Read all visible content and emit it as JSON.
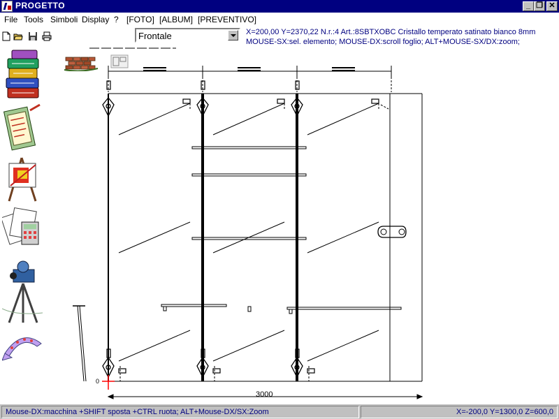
{
  "window": {
    "title": "PROGETTO",
    "min_glyph": "_",
    "restore_glyph": "❐",
    "close_glyph": "✕"
  },
  "menu": [
    "File",
    "Tools",
    "Simboli",
    "Display",
    "?",
    "[FOTO]",
    "[ALBUM]",
    "[PREVENTIVO]"
  ],
  "toolbar": {
    "view_select": "Frontale",
    "coord_line": "X=200,00    Y=2370,22  N.r.:4 Art.:8SBTXOBC Cristallo temperato satinato bianco 8mm",
    "hint_line": "MOUSE-SX:sel. elemento; MOUSE-DX:scroll foglio; ALT+MOUSE-SX/DX:zoom;"
  },
  "drawing": {
    "width_dimension": "3000",
    "origin_label": "0"
  },
  "status": {
    "left": "Mouse-DX:macchina +SHIFT sposta +CTRL ruota; ALT+Mouse-DX/SX:Zoom",
    "right": "X=-200,0 Y=1300,0 Z=600,0"
  },
  "colors": {
    "titlebar": "#000080",
    "info_text": "#000080",
    "origin_axis": "#ff0000"
  },
  "icons": [
    "new-file-icon",
    "open-folder-icon",
    "save-disk-icon",
    "print-icon",
    "brick-wall-icon",
    "layout-view-icon",
    "books-icon",
    "clipboard-list-icon",
    "easel-chart-icon",
    "calculator-papers-icon",
    "camera-tripod-icon",
    "preview-arrow-icon"
  ]
}
